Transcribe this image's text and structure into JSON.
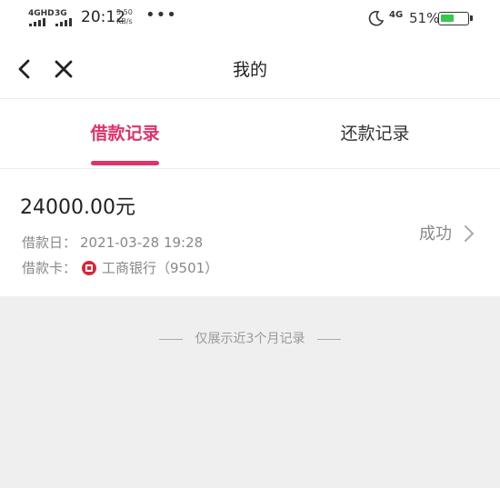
{
  "status_bar": {
    "network1": "4GHD",
    "network2": "3G",
    "time": "20:12",
    "speed_value": "5.50",
    "speed_unit": "KB/s",
    "more": "•••",
    "network_right": "4G",
    "battery_text": "51%",
    "battery_level": 0.51,
    "battery_color": "#34c94b"
  },
  "nav": {
    "title": "我的",
    "back_icon": "chevron-left-icon",
    "close_icon": "close-icon"
  },
  "tabs": [
    {
      "label": "借款记录",
      "active": true
    },
    {
      "label": "还款记录",
      "active": false
    }
  ],
  "accent_color": "#e0336a",
  "record": {
    "amount": "24000.00元",
    "date_label": "借款日：",
    "date_value": "2021-03-28 19:28",
    "card_label": "借款卡：",
    "bank_name": "工商银行（9501）",
    "status": "成功"
  },
  "footnote": "仅展示近3个月记录"
}
